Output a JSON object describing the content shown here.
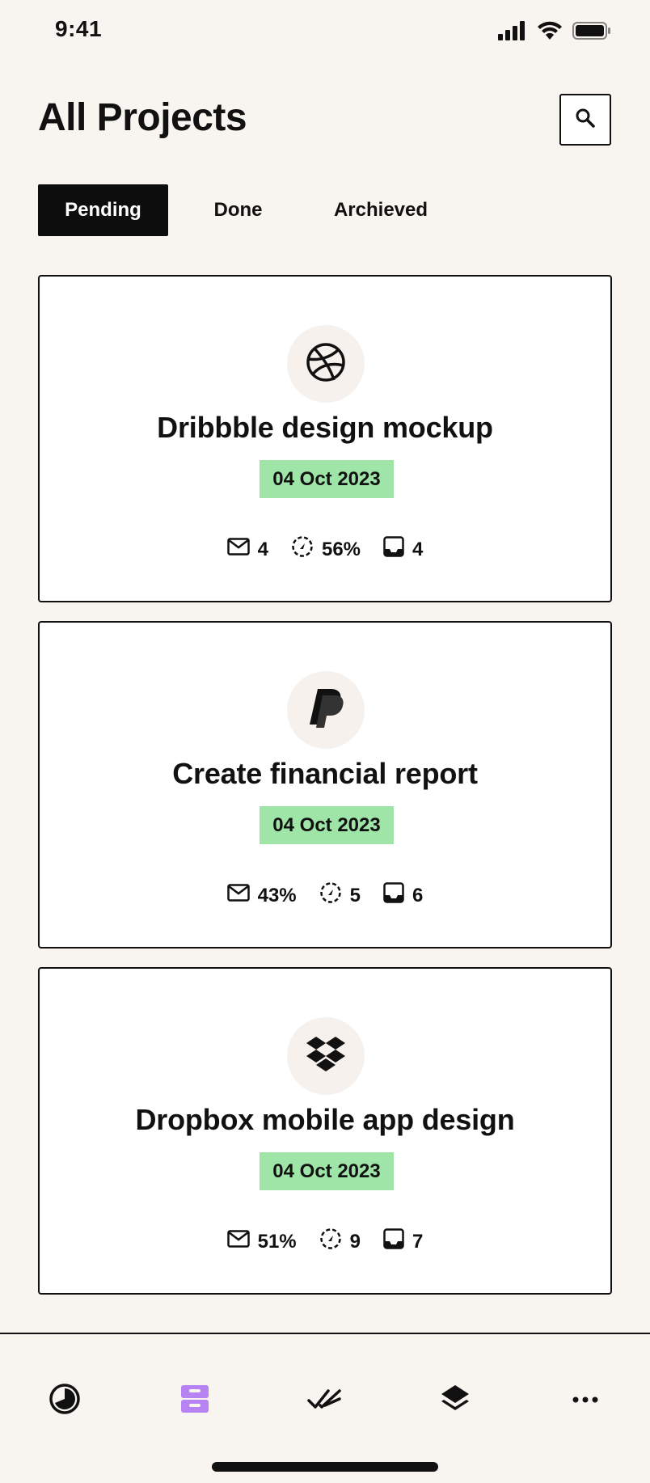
{
  "status_bar": {
    "time": "9:41"
  },
  "header": {
    "title": "All Projects",
    "search_icon": "search-icon"
  },
  "tabs": [
    {
      "label": "Pending",
      "active": true
    },
    {
      "label": "Done",
      "active": false
    },
    {
      "label": "Archieved",
      "active": false
    }
  ],
  "projects": [
    {
      "icon": "dribbble-icon",
      "title": "Dribbble design mockup",
      "date": "04 Oct 2023",
      "stats": {
        "messages": "4",
        "progress": "56%",
        "files": "4"
      }
    },
    {
      "icon": "paypal-icon",
      "title": "Create financial report",
      "date": "04 Oct 2023",
      "stats": {
        "messages": "43%",
        "progress": "5",
        "files": "6"
      }
    },
    {
      "icon": "dropbox-icon",
      "title": "Dropbox mobile app design",
      "date": "04 Oct 2023",
      "stats": {
        "messages": "51%",
        "progress": "9",
        "files": "7"
      }
    }
  ],
  "bottom_nav": [
    {
      "icon": "dashboard-icon"
    },
    {
      "icon": "projects-icon",
      "active": true
    },
    {
      "icon": "tasks-done-icon"
    },
    {
      "icon": "layers-icon"
    },
    {
      "icon": "more-icon"
    }
  ],
  "colors": {
    "background": "#f8f4ef",
    "accent_green": "#9fe5a8",
    "accent_purple": "#b783f2",
    "dark": "#0d0d0d"
  }
}
